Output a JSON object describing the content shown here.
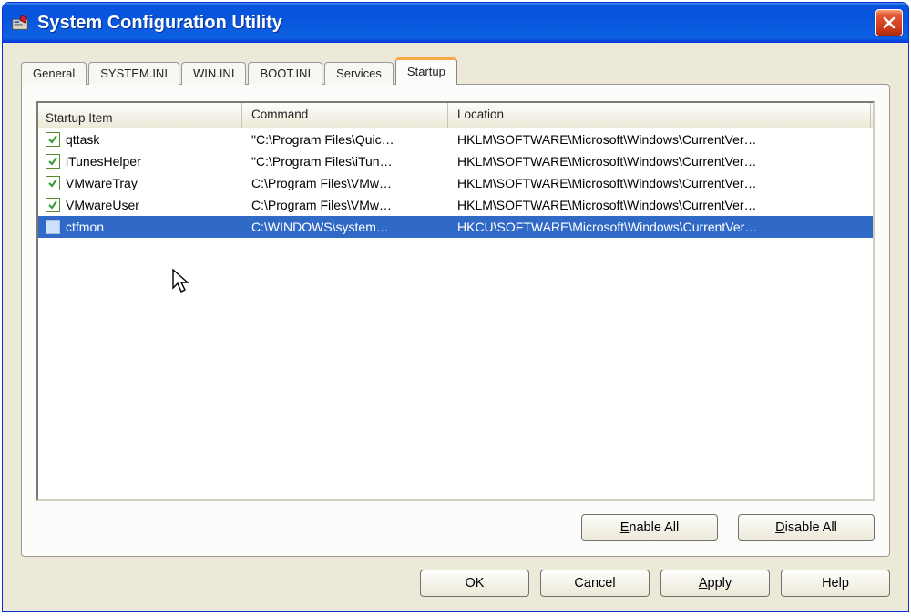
{
  "window": {
    "title": "System Configuration Utility"
  },
  "tabs": [
    {
      "label": "General"
    },
    {
      "label": "SYSTEM.INI"
    },
    {
      "label": "WIN.INI"
    },
    {
      "label": "BOOT.INI"
    },
    {
      "label": "Services"
    },
    {
      "label": "Startup",
      "active": true
    }
  ],
  "columns": {
    "startup_item": "Startup Item",
    "command": "Command",
    "location": "Location"
  },
  "rows": [
    {
      "checked": true,
      "selected": false,
      "item": "qttask",
      "command": "\"C:\\Program Files\\Quic…",
      "location": "HKLM\\SOFTWARE\\Microsoft\\Windows\\CurrentVer…"
    },
    {
      "checked": true,
      "selected": false,
      "item": "iTunesHelper",
      "command": "\"C:\\Program Files\\iTun…",
      "location": "HKLM\\SOFTWARE\\Microsoft\\Windows\\CurrentVer…"
    },
    {
      "checked": true,
      "selected": false,
      "item": "VMwareTray",
      "command": "C:\\Program Files\\VMw…",
      "location": "HKLM\\SOFTWARE\\Microsoft\\Windows\\CurrentVer…"
    },
    {
      "checked": true,
      "selected": false,
      "item": "VMwareUser",
      "command": "C:\\Program Files\\VMw…",
      "location": "HKLM\\SOFTWARE\\Microsoft\\Windows\\CurrentVer…"
    },
    {
      "checked": false,
      "selected": true,
      "item": "ctfmon",
      "command": "C:\\WINDOWS\\system…",
      "location": "HKCU\\SOFTWARE\\Microsoft\\Windows\\CurrentVer…"
    }
  ],
  "buttons": {
    "enable_all": "Enable All",
    "disable_all": "Disable All",
    "ok": "OK",
    "cancel": "Cancel",
    "apply": "Apply",
    "help": "Help",
    "enable_all_mnemonic": "E",
    "disable_all_mnemonic": "D",
    "apply_mnemonic": "A"
  }
}
